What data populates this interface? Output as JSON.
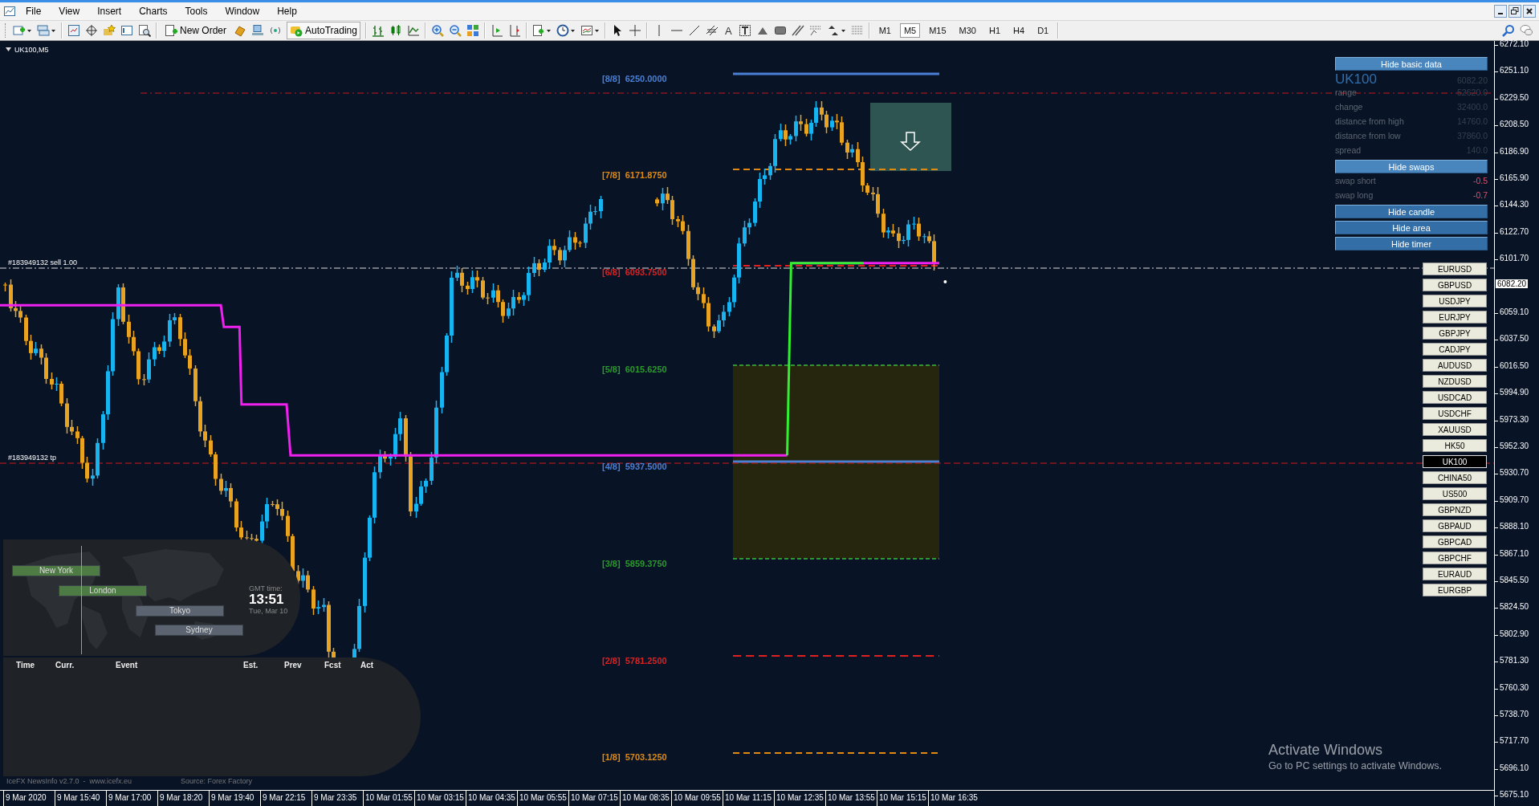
{
  "menu": [
    "File",
    "View",
    "Insert",
    "Charts",
    "Tools",
    "Window",
    "Help"
  ],
  "toolbar": {
    "new_order": "New Order",
    "autotrading": "AutoTrading",
    "text_tool": "A",
    "timeframes": [
      {
        "label": "M1",
        "selected": false
      },
      {
        "label": "M5",
        "selected": true
      },
      {
        "label": "M15",
        "selected": false
      },
      {
        "label": "M30",
        "selected": false
      },
      {
        "label": "H1",
        "selected": false
      },
      {
        "label": "H4",
        "selected": false
      },
      {
        "label": "D1",
        "selected": false
      }
    ]
  },
  "chart": {
    "symbol": "UK100,M5",
    "murrey_levels": [
      {
        "label": "[8/8]",
        "price": "6250.0000",
        "color": "#4a7fd6"
      },
      {
        "label": "[7/8]",
        "price": "6171.8750",
        "color": "#e08a10"
      },
      {
        "label": "[6/8]",
        "price": "6093.7500",
        "color": "#e02020"
      },
      {
        "label": "[5/8]",
        "price": "6015.6250",
        "color": "#2a9a2a"
      },
      {
        "label": "[4/8]",
        "price": "5937.5000",
        "color": "#4a7fd6"
      },
      {
        "label": "[3/8]",
        "price": "5859.3750",
        "color": "#2a9a2a"
      },
      {
        "label": "[2/8]",
        "price": "5781.2500",
        "color": "#e02020"
      },
      {
        "label": "[1/8]",
        "price": "5703.1250",
        "color": "#e08a10"
      }
    ],
    "trade_lines": [
      {
        "kind": "entry",
        "label": "#183949132 sell 1.00"
      },
      {
        "kind": "take_profit",
        "label": "#183949132 tp"
      }
    ],
    "info_panel": {
      "toggle_basic": "Hide basic data",
      "symbol": "UK100",
      "price": "6082.20",
      "rows": [
        {
          "label": "range",
          "value": "52620.0"
        },
        {
          "label": "change",
          "value": "32400.0"
        },
        {
          "label": "distance from high",
          "value": "14760.0"
        },
        {
          "label": "distance from low",
          "value": "37860.0"
        },
        {
          "label": "spread",
          "value": "140.0"
        }
      ],
      "toggle_swaps": "Hide swaps",
      "swaps": [
        {
          "label": "swap short",
          "value": "-0.5"
        },
        {
          "label": "swap long",
          "value": "-0.7"
        }
      ],
      "buttons": [
        "Hide candle",
        "Hide area",
        "Hide timer"
      ]
    },
    "symbols": [
      {
        "label": "EURUSD",
        "selected": false
      },
      {
        "label": "GBPUSD",
        "selected": false
      },
      {
        "label": "USDJPY",
        "selected": false
      },
      {
        "label": "EURJPY",
        "selected": false
      },
      {
        "label": "GBPJPY",
        "selected": false
      },
      {
        "label": "CADJPY",
        "selected": false
      },
      {
        "label": "AUDUSD",
        "selected": false
      },
      {
        "label": "NZDUSD",
        "selected": false
      },
      {
        "label": "USDCAD",
        "selected": false
      },
      {
        "label": "USDCHF",
        "selected": false
      },
      {
        "label": "XAUUSD",
        "selected": false
      },
      {
        "label": "HK50",
        "selected": false
      },
      {
        "label": "UK100",
        "selected": true
      },
      {
        "label": "CHINA50",
        "selected": false
      },
      {
        "label": "US500",
        "selected": false
      },
      {
        "label": "GBPNZD",
        "selected": false
      },
      {
        "label": "GBPAUD",
        "selected": false
      },
      {
        "label": "GBPCAD",
        "selected": false
      },
      {
        "label": "GBPCHF",
        "selected": false
      },
      {
        "label": "EURAUD",
        "selected": false
      },
      {
        "label": "EURGBP",
        "selected": false
      }
    ],
    "news_widget": {
      "sessions": [
        {
          "label": "New York",
          "active": true
        },
        {
          "label": "London",
          "active": true
        },
        {
          "label": "Tokyo",
          "active": false
        },
        {
          "label": "Sydney",
          "active": false
        }
      ],
      "gmt_label": "GMT time:",
      "gmt_time": "13:51",
      "gmt_date": "Tue, Mar 10",
      "columns": [
        "Time",
        "Curr.",
        "Event",
        "Est.",
        "Prev",
        "Fcst",
        "Act"
      ],
      "footer": "IceFX NewsInfo v2.7.0  -  www.icefx.eu",
      "source": "Source: Forex Factory"
    },
    "activation": {
      "title": "Activate Windows",
      "subtitle": "Go to PC settings to activate Windows."
    }
  },
  "price_axis": {
    "ticks": [
      "6272.10",
      "6251.10",
      "6229.50",
      "6208.50",
      "6186.90",
      "6165.90",
      "6144.30",
      "6122.70",
      "6101.70",
      "6059.10",
      "6037.50",
      "6016.50",
      "5994.90",
      "5973.30",
      "5952.30",
      "5930.70",
      "5909.70",
      "5888.10",
      "5867.10",
      "5845.50",
      "5824.50",
      "5802.90",
      "5781.30",
      "5760.30",
      "5738.70",
      "5717.70",
      "5696.10",
      "5675.10"
    ],
    "current_price": "6082.20"
  },
  "time_axis": [
    "9 Mar 2020",
    "9 Mar 15:40",
    "9 Mar 17:00",
    "9 Mar 18:20",
    "9 Mar 19:40",
    "9 Mar 22:15",
    "9 Mar 23:35",
    "10 Mar 01:55",
    "10 Mar 03:15",
    "10 Mar 04:35",
    "10 Mar 05:55",
    "10 Mar 07:15",
    "10 Mar 08:35",
    "10 Mar 09:55",
    "10 Mar 11:15",
    "10 Mar 12:35",
    "10 Mar 13:55",
    "10 Mar 15:15",
    "10 Mar 16:35"
  ]
}
